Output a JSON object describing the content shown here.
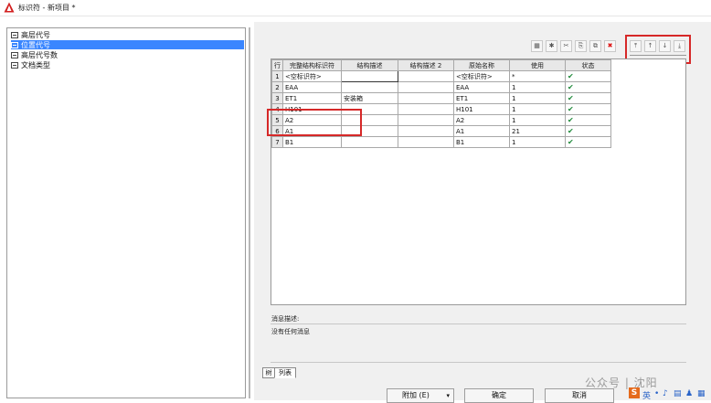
{
  "window": {
    "title": "标识符 - 新项目 *"
  },
  "tree": {
    "items": [
      {
        "label": "高层代号",
        "selected": false
      },
      {
        "label": "位置代号",
        "selected": true
      },
      {
        "label": "高层代号数",
        "selected": false
      },
      {
        "label": "文档类型",
        "selected": false
      }
    ]
  },
  "toolbar": {
    "left_icons": [
      "table-icon",
      "star-icon",
      "cut-icon",
      "copy-icon",
      "paste-icon",
      "delete-icon"
    ],
    "left_glyphs": [
      "▦",
      "✱",
      "✂",
      "⎘",
      "⧉",
      "✖"
    ],
    "nav_icons": [
      "move-top-icon",
      "move-up-icon",
      "move-down-icon",
      "move-bottom-icon"
    ],
    "nav_glyphs": [
      "⤒",
      "↑",
      "↓",
      "⤓"
    ],
    "highlight_color": "#d62828"
  },
  "grid": {
    "headers": [
      "行",
      "完整结构标识符",
      "结构描述",
      "结构描述 2",
      "原始名称",
      "使用",
      "状态"
    ],
    "rows": [
      {
        "row": "1",
        "id": "<空标识符>",
        "desc": "",
        "desc2": "",
        "orig": "<空标识符>",
        "use": "*",
        "status": "✔"
      },
      {
        "row": "2",
        "id": "EAA",
        "desc": "",
        "desc2": "",
        "orig": "EAA",
        "use": "1",
        "status": "✔"
      },
      {
        "row": "3",
        "id": "ET1",
        "desc": "安装箱",
        "desc2": "",
        "orig": "ET1",
        "use": "1",
        "status": "✔"
      },
      {
        "row": "4",
        "id": "H101",
        "desc": "",
        "desc2": "",
        "orig": "H101",
        "use": "1",
        "status": "✔"
      },
      {
        "row": "5",
        "id": "A2",
        "desc": "",
        "desc2": "",
        "orig": "A2",
        "use": "1",
        "status": "✔"
      },
      {
        "row": "6",
        "id": "A1",
        "desc": "",
        "desc2": "",
        "orig": "A1",
        "use": "21",
        "status": "✔"
      },
      {
        "row": "7",
        "id": "B1",
        "desc": "",
        "desc2": "",
        "orig": "B1",
        "use": "1",
        "status": "✔"
      }
    ],
    "status_color": "#1f8a3a"
  },
  "message": {
    "label": "消息描述:",
    "text": "没有任何消息"
  },
  "tabs": {
    "form": "树",
    "list": "列表"
  },
  "buttons": {
    "append": "附加 (E)",
    "append_arrow": "▾",
    "ok": "确定",
    "cancel": "取消"
  },
  "watermark": {
    "text": "公众号 | 沈阳"
  }
}
